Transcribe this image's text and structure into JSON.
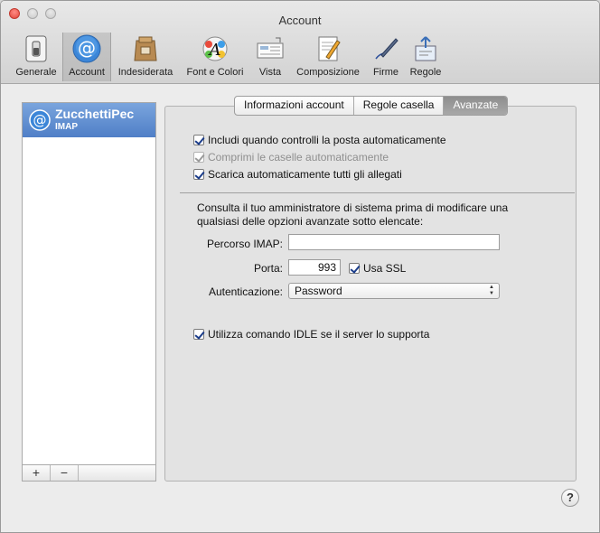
{
  "window": {
    "title": "Account"
  },
  "toolbar": {
    "items": [
      {
        "label": "Generale",
        "icon": "switch-icon"
      },
      {
        "label": "Account",
        "icon": "at-icon"
      },
      {
        "label": "Indesiderata",
        "icon": "junk-bag-icon"
      },
      {
        "label": "Font e Colori",
        "icon": "font-palette-icon"
      },
      {
        "label": "Vista",
        "icon": "view-icon"
      },
      {
        "label": "Composizione",
        "icon": "compose-icon"
      },
      {
        "label": "Firme",
        "icon": "signature-pen-icon"
      },
      {
        "label": "Regole",
        "icon": "rules-icon"
      }
    ],
    "selected": "Account"
  },
  "sidebar": {
    "account": {
      "name": "ZucchettiPec",
      "type": "IMAP"
    },
    "add_label": "+",
    "remove_label": "−"
  },
  "tabs": [
    {
      "label": "Informazioni account"
    },
    {
      "label": "Regole casella"
    },
    {
      "label": "Avanzate"
    }
  ],
  "active_tab": "Avanzate",
  "options": {
    "include_auto_check": {
      "label": "Includi quando controlli la posta automaticamente",
      "checked": true
    },
    "compact_auto": {
      "label": "Comprimi le caselle automaticamente",
      "checked": true,
      "enabled": false
    },
    "download_attachments": {
      "label": "Scarica automaticamente tutti gli allegati",
      "checked": true
    }
  },
  "note": "Consulta il tuo amministratore di sistema prima di modificare una qualsiasi delle opzioni avanzate sotto elencate:",
  "imap_path": {
    "label": "Percorso IMAP:",
    "value": ""
  },
  "port": {
    "label": "Porta:",
    "value": "993"
  },
  "ssl": {
    "label": "Usa SSL",
    "checked": true
  },
  "auth": {
    "label": "Autenticazione:",
    "value": "Password"
  },
  "idle": {
    "label": "Utilizza comando IDLE se il server lo supporta",
    "checked": true
  },
  "help_label": "?"
}
